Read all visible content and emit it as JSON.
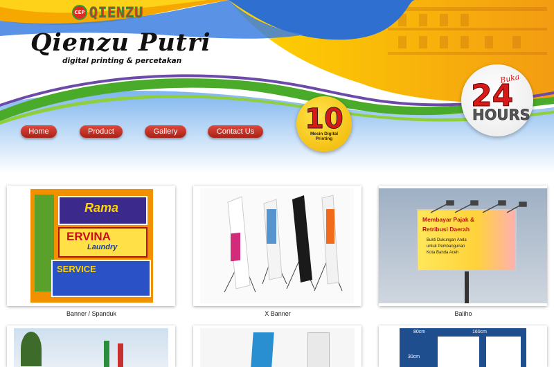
{
  "header": {
    "small_logo_badge": "CEP",
    "small_logo_word": "QIENZU",
    "brand_name": "Qienzu Putri",
    "tagline": "digital printing & percetakan",
    "badge_10": {
      "number": "10",
      "caption": "Mesin Digital Printing"
    },
    "badge_24": {
      "number": "24",
      "label": "HOURS",
      "top": "Buka"
    }
  },
  "nav": {
    "items": [
      {
        "label": "Home"
      },
      {
        "label": "Product"
      },
      {
        "label": "Gallery"
      },
      {
        "label": "Contact Us"
      }
    ]
  },
  "gallery": {
    "items": [
      {
        "caption": "Banner / Spanduk"
      },
      {
        "caption": "X Banner"
      },
      {
        "caption": "Baliho"
      }
    ]
  },
  "thumbs": {
    "banner": {
      "line1": "ERVINA",
      "line2": "Laundry",
      "line3": "SERVICE",
      "line4": "Rama"
    },
    "baliho": {
      "line1": "Membayar Pajak &",
      "line2": "Retribusi Daerah",
      "line3": "Bukti Dukungan Anda",
      "line4": "untuk Pembangunan",
      "line5": "Kota Banda Aceh"
    },
    "bottom": {
      "size1": "80cm",
      "size2": "30cm",
      "size3": "160cm"
    }
  },
  "colors": {
    "nav_red": "#c6301f",
    "green": "#2f9b3c",
    "yellow": "#f6c400",
    "blue": "#2e6fd0"
  }
}
